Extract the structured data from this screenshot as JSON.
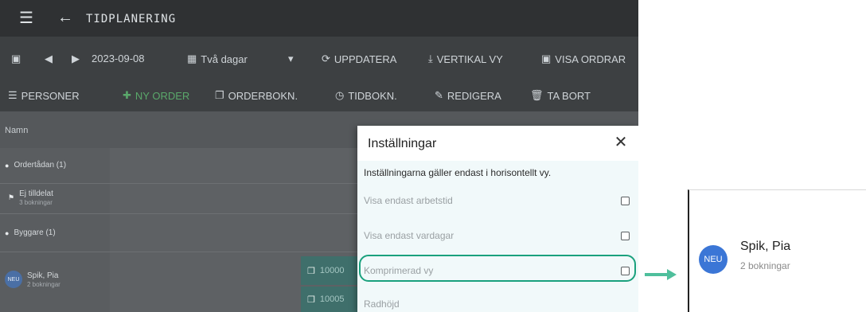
{
  "titlebar": {
    "title": "TIDPLANERING"
  },
  "toolbar1": {
    "date": "2023-09-08",
    "view_select": "Två dagar",
    "update_label": "UPPDATERA",
    "vertical_label": "VERTIKAL VY",
    "show_orders_label": "VISA ORDRAR"
  },
  "toolbar2": {
    "persons_label": "PERSONER",
    "new_order_label": "NY ORDER",
    "order_booking_label": "ORDERBOKN.",
    "time_booking_label": "TIDBOKN.",
    "edit_label": "REDIGERA",
    "delete_label": "TA BORT"
  },
  "grid": {
    "column_header": "Namn",
    "rows": [
      {
        "label": "Ordertådan (1)"
      },
      {
        "label": "Ej tilldelat",
        "sub": "3 bokningar"
      },
      {
        "label": "Byggare (1)"
      },
      {
        "label": "Spik, Pia",
        "sub": "2 bokningar",
        "initials": "NEU"
      }
    ],
    "bookings": [
      "10000",
      "10005"
    ]
  },
  "dialog": {
    "title": "Inställningar",
    "info": "Inställningarna gäller endast i horisontellt vy.",
    "options": [
      {
        "label": "Visa endast arbetstid",
        "checked": false
      },
      {
        "label": "Visa endast vardagar",
        "checked": false
      },
      {
        "label": "Komprimerad vy",
        "checked": false
      },
      {
        "label": "Radhöjd"
      }
    ]
  },
  "zoom": {
    "initials": "NEU",
    "name": "Spik, Pia",
    "sub": "2 bokningar"
  },
  "colors": {
    "highlight": "#1aa17d",
    "avatar": "#3b76d6",
    "new_order": "#5aa86b"
  }
}
